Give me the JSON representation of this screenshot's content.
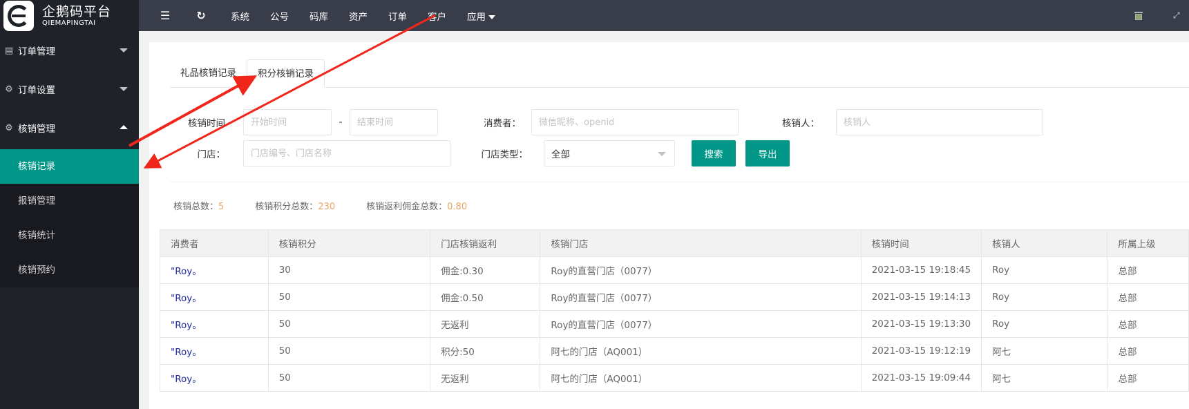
{
  "brand": {
    "name_cn": "企鹅码平台",
    "name_en": "QIEMAPINGTAI"
  },
  "topnav": {
    "items": [
      "系统",
      "公号",
      "码库",
      "资产",
      "订单",
      "客户",
      "应用"
    ],
    "icons": [
      "collapse-menu-icon",
      "refresh-icon",
      "trash-icon",
      "fullscreen-icon"
    ]
  },
  "sidebar": {
    "groups": [
      {
        "label": "订单管理",
        "icon": "clipboard-icon",
        "expanded": false
      },
      {
        "label": "订单设置",
        "icon": "gear-icon",
        "expanded": false
      },
      {
        "label": "核销管理",
        "icon": "gear-icon",
        "expanded": true
      }
    ],
    "subitems": [
      "核销记录",
      "报销管理",
      "核销统计",
      "核销预约"
    ],
    "active": "核销记录"
  },
  "tabs": [
    "礼品核销记录",
    "积分核销记录"
  ],
  "active_tab": "积分核销记录",
  "filters": {
    "time_label": "核销时间",
    "start_placeholder": "开始时间",
    "separator": "-",
    "end_placeholder": "结束时间",
    "consumer_label": "消费者：",
    "consumer_placeholder": "微信昵称、openid",
    "verifier_label": "核销人：",
    "verifier_placeholder": "核销人",
    "store_label": "门店：",
    "store_placeholder": "门店编号、门店名称",
    "store_type_label": "门店类型：",
    "store_type_value": "全部",
    "search_label": "搜索",
    "export_label": "导出"
  },
  "stats": [
    {
      "label": "核销总数：",
      "value": "5"
    },
    {
      "label": "核销积分总数：",
      "value": "230"
    },
    {
      "label": "核销返利佣金总数：",
      "value": "0.80"
    }
  ],
  "table": {
    "headers": [
      "消费者",
      "核销积分",
      "门店核销返利",
      "核销门店",
      "核销时间",
      "核销人",
      "所属上级"
    ],
    "rows": [
      [
        "\"Roy。",
        "30",
        "佣金:0.30",
        "Roy的直营门店（0077）",
        "2021-03-15 19:18:45",
        "Roy",
        "总部"
      ],
      [
        "\"Roy。",
        "50",
        "佣金:0.50",
        "Roy的直营门店（0077）",
        "2021-03-15 19:14:13",
        "Roy",
        "总部"
      ],
      [
        "\"Roy。",
        "50",
        "无返利",
        "Roy的直营门店（0077）",
        "2021-03-15 19:13:30",
        "Roy",
        "总部"
      ],
      [
        "\"Roy。",
        "50",
        "积分:50",
        "阿七的门店（AQ001）",
        "2021-03-15 19:12:19",
        "阿七",
        "总部"
      ],
      [
        "\"Roy。",
        "50",
        "无返利",
        "阿七的门店（AQ001）",
        "2021-03-15 19:09:44",
        "阿七",
        "总部"
      ]
    ]
  },
  "colors": {
    "accent": "#009688",
    "topbar": "#393d49",
    "sidebar": "#20222a",
    "stat_value": "#e8a663",
    "link": "#1e2a9b",
    "annotation": "#f0261b"
  }
}
